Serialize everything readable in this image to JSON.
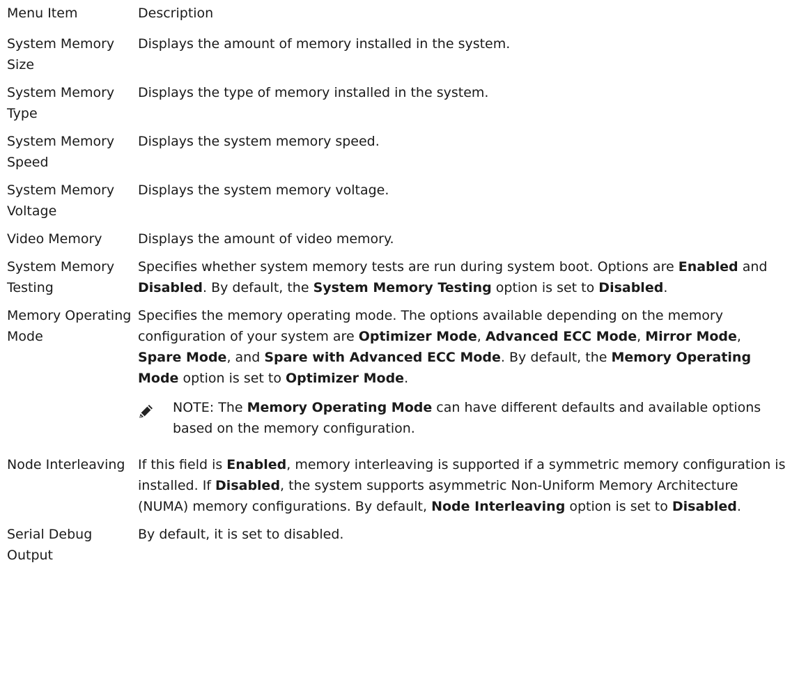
{
  "header": {
    "col1": "Menu Item",
    "col2": "Description"
  },
  "rows": {
    "size": {
      "term": "System Memory Size",
      "desc": "Displays the amount of memory installed in the system."
    },
    "type": {
      "term": "System Memory Type",
      "desc": "Displays the type of memory installed in the system."
    },
    "speed": {
      "term": "System Memory Speed",
      "desc": "Displays the system memory speed."
    },
    "volt": {
      "term": "System Memory Voltage",
      "desc": "Displays the system memory voltage."
    },
    "video": {
      "term": "Video Memory",
      "desc": "Displays the amount of video memory."
    },
    "testing": {
      "term": "System Memory Testing",
      "p1": "Specifies whether system memory tests are run during system boot. Options are ",
      "b1": "Enabled",
      "p2": " and ",
      "b2": "Disabled",
      "p3": ". By default, the ",
      "b3": "System Memory Testing",
      "p4": " option is set to ",
      "b4": "Disabled",
      "p5": "."
    },
    "mode": {
      "term": "Memory Operating Mode",
      "p1": "Specifies the memory operating mode. The options available depending on the memory configuration of your system are ",
      "b1": "Optimizer Mode",
      "p2": ", ",
      "b2": "Advanced ECC Mode",
      "p3": ", ",
      "b3": "Mirror Mode",
      "p4": ", ",
      "b4": "Spare Mode",
      "p5": ", and ",
      "b5": "Spare with Advanced ECC Mode",
      "p6": ". By default, the ",
      "b6": "Memory Operating Mode",
      "p7": " option is set to ",
      "b7": "Optimizer Mode",
      "p8": "."
    },
    "note": {
      "icon": "pencil-icon",
      "label": "NOTE:",
      "p1": " The ",
      "b1": "Memory Operating Mode",
      "p2": " can have different defaults and available options based on the memory configuration."
    },
    "node": {
      "term": "Node Interleaving",
      "p1": "If this field is ",
      "b1": "Enabled",
      "p2": ", memory interleaving is supported if a symmetric memory configuration is installed. If ",
      "b2": "Disabled",
      "p3": ", the system supports asymmetric Non-Uniform Memory Architecture (NUMA) memory configurations. By default, ",
      "b3": "Node Interleaving",
      "p4": " option is set to ",
      "b4": "Disabled",
      "p5": "."
    },
    "serial": {
      "term": "Serial Debug Output",
      "desc": "By default, it is set to disabled."
    }
  }
}
